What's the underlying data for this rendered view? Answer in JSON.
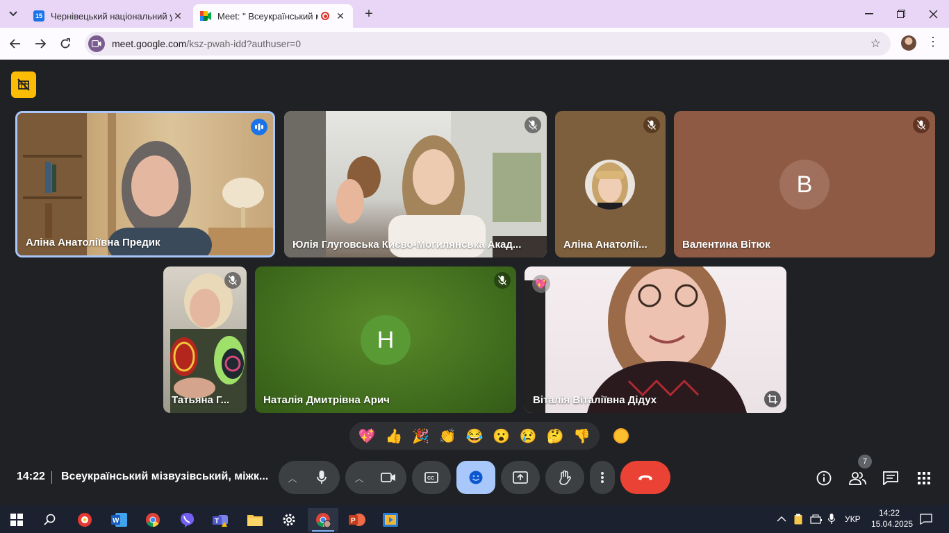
{
  "browser": {
    "tabs": [
      {
        "title": "Чернівецький національний у",
        "favicon_text": "15",
        "active": false
      },
      {
        "title": "Meet: \" Всеукраїнський міз",
        "active": true
      }
    ],
    "url_host": "meet.google.com",
    "url_path": "/ksz-pwah-idd?authuser=0"
  },
  "participants": [
    {
      "name": "Аліна Анатоліївна Предик",
      "speaking": true
    },
    {
      "name": "Юлія Глуговська Києво-Могилянська Акад...",
      "muted": true
    },
    {
      "name": "Аліна Анатолії...",
      "muted": true
    },
    {
      "name": "Валентина Вітюк",
      "avatar_letter": "В",
      "avatar_color": "#8e5a44",
      "muted": true
    },
    {
      "name": "Татьяна Г...",
      "muted": true
    },
    {
      "name": "Наталія Дмитрівна Арич",
      "avatar_letter": "Н",
      "avatar_color": "#5a9a35",
      "muted": true
    },
    {
      "name": "Віталія Віталіївна Дідух",
      "reaction": "💖"
    }
  ],
  "reactions": [
    "💖",
    "👍",
    "🎉",
    "👏",
    "😂",
    "😮",
    "😢",
    "🤔",
    "👎"
  ],
  "footer": {
    "time": "14:22",
    "meeting_title": "Всеукраїнський мізвузівський, міжк...",
    "participants_count": "7"
  },
  "colors": {
    "end_call": "#ea4335",
    "reactions_active": "#a8c7fa",
    "speaking_border": "#a8c7fa"
  },
  "taskbar": {
    "lang": "УКР",
    "time": "14:22",
    "date": "15.04.2025",
    "apps": [
      "start-icon",
      "search-icon",
      "yandex-icon",
      "word-icon",
      "chrome-icon",
      "viber-icon",
      "teams-icon",
      "explorer-icon",
      "settings-icon",
      "chrome-profile-icon",
      "powerpoint-icon",
      "video-icon"
    ]
  }
}
